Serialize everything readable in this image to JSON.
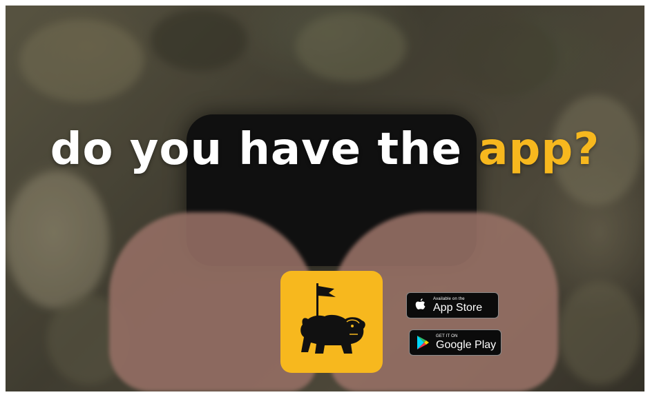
{
  "headline": {
    "lead": "do you have the",
    "accent": "app?"
  },
  "app_icon": {
    "icon": "bulldog-with-flag-icon",
    "background": "#f7b81e"
  },
  "app_store_badge": {
    "small_text": "Available on the",
    "big_text": "App Store",
    "icon": "apple-icon"
  },
  "google_play_badge": {
    "small_text": "GET IT ON",
    "big_text": "Google Play",
    "icon": "play-triangle-icon"
  },
  "colors": {
    "accent": "#f7b81e",
    "headline": "#ffffff",
    "badge_bg": "#0b0b0b"
  }
}
